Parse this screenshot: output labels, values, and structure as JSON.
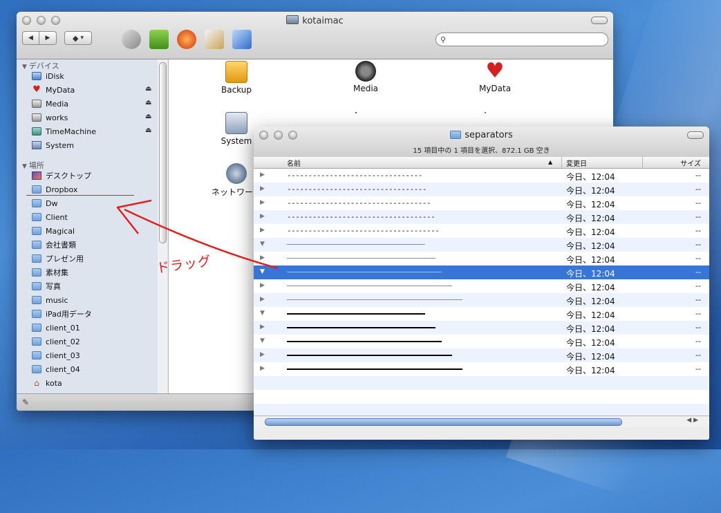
{
  "window_main": {
    "title": "kotaimac",
    "search_placeholder": "",
    "sidebar": {
      "devices_header": "デバイス",
      "devices": [
        {
          "label": "iDisk",
          "icon": "idisk-icon",
          "eject": false
        },
        {
          "label": "MyData",
          "icon": "heart-disk-icon",
          "eject": true
        },
        {
          "label": "Media",
          "icon": "headphones-disk-icon",
          "eject": true
        },
        {
          "label": "works",
          "icon": "disk-icon",
          "eject": true
        },
        {
          "label": "TimeMachine",
          "icon": "timemachine-disk-icon",
          "eject": true
        },
        {
          "label": "System",
          "icon": "system-disk-icon",
          "eject": false
        }
      ],
      "places_header": "場所",
      "places": [
        {
          "label": "デスクトップ",
          "icon": "desktop-icon"
        },
        {
          "label": "Dropbox",
          "icon": "folder-icon"
        },
        {
          "label": "Dw",
          "icon": "folder-icon"
        },
        {
          "label": "Client",
          "icon": "folder-icon"
        },
        {
          "label": "Magical",
          "icon": "folder-icon"
        },
        {
          "label": "会社書類",
          "icon": "folder-icon"
        },
        {
          "label": "プレゼン用",
          "icon": "folder-icon"
        },
        {
          "label": "素材集",
          "icon": "folder-icon"
        },
        {
          "label": "写真",
          "icon": "folder-icon"
        },
        {
          "label": "music",
          "icon": "folder-icon"
        },
        {
          "label": "iPad用データ",
          "icon": "folder-icon"
        },
        {
          "label": "client_01",
          "icon": "folder-icon"
        },
        {
          "label": "client_02",
          "icon": "folder-icon"
        },
        {
          "label": "client_03",
          "icon": "folder-icon"
        },
        {
          "label": "client_04",
          "icon": "folder-icon"
        },
        {
          "label": "kota",
          "icon": "home-icon"
        }
      ]
    },
    "content_items": [
      {
        "label": "Backup"
      },
      {
        "label": "Media"
      },
      {
        "label": "MyData"
      },
      {
        "label": "System"
      },
      {
        "label": "ネットワーク"
      }
    ]
  },
  "window_separators": {
    "title": "separators",
    "status": "15 項目中の 1 項目を選択、872.1 GB 空き",
    "columns": {
      "name": "名前",
      "date": "変更日",
      "size": "サイズ"
    },
    "rows": [
      {
        "expanded": false,
        "style": "dash",
        "name": "--------------------------------",
        "date": "今日、12:04",
        "size": "--"
      },
      {
        "expanded": false,
        "style": "dash",
        "name": "---------------------------------",
        "date": "今日、12:04",
        "size": "--"
      },
      {
        "expanded": false,
        "style": "dash",
        "name": "----------------------------------",
        "date": "今日、12:04",
        "size": "--"
      },
      {
        "expanded": false,
        "style": "dash",
        "name": "-----------------------------------",
        "date": "今日、12:04",
        "size": "--"
      },
      {
        "expanded": false,
        "style": "dash",
        "name": "------------------------------------",
        "date": "今日、12:04",
        "size": "--"
      },
      {
        "expanded": true,
        "style": "thin",
        "line": 0.41,
        "date": "今日、12:04",
        "size": "--"
      },
      {
        "expanded": false,
        "style": "thin",
        "line": 0.44,
        "date": "今日、12:04",
        "size": "--"
      },
      {
        "expanded": true,
        "style": "thin",
        "line": 0.46,
        "date": "今日、12:04",
        "size": "--",
        "selected": true
      },
      {
        "expanded": false,
        "style": "thin",
        "line": 0.49,
        "date": "今日、12:04",
        "size": "--"
      },
      {
        "expanded": false,
        "style": "thin",
        "line": 0.52,
        "date": "今日、12:04",
        "size": "--"
      },
      {
        "expanded": true,
        "style": "thick",
        "line": 0.41,
        "date": "今日、12:04",
        "size": "--"
      },
      {
        "expanded": false,
        "style": "thick",
        "line": 0.44,
        "date": "今日、12:04",
        "size": "--"
      },
      {
        "expanded": true,
        "style": "thick",
        "line": 0.46,
        "date": "今日、12:04",
        "size": "--"
      },
      {
        "expanded": false,
        "style": "thick",
        "line": 0.49,
        "date": "今日、12:04",
        "size": "--"
      },
      {
        "expanded": false,
        "style": "thick",
        "line": 0.52,
        "date": "今日、12:04",
        "size": "--"
      }
    ]
  },
  "annotation": {
    "label": "ドラッグ",
    "color": "#e02020"
  },
  "colors": {
    "selection": "#3875d7",
    "sidebar_bg": "#dde4ee",
    "alt_row": "#edf3fe"
  }
}
